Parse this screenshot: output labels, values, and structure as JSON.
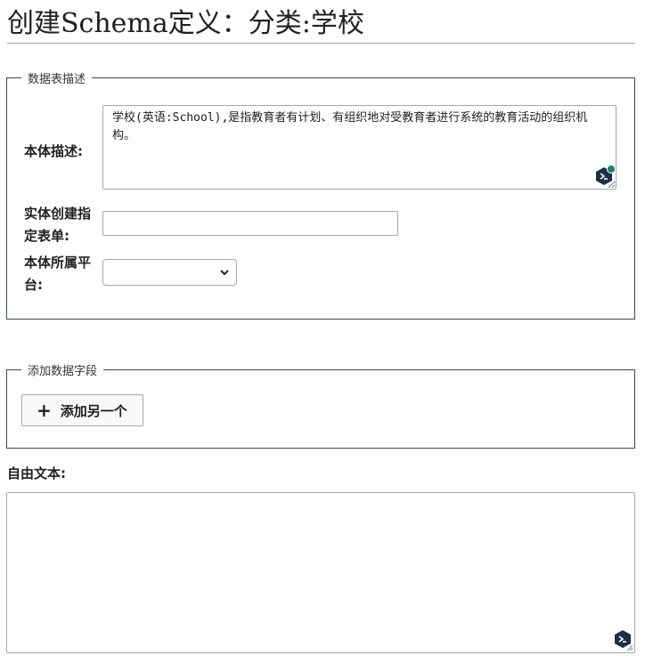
{
  "page": {
    "title": "创建Schema定义：分类:学校"
  },
  "description_section": {
    "legend": "数据表描述",
    "entity_description_label": "本体描述:",
    "entity_description_value": "学校(英语:School),是指教育者有计划、有组织地对受教育者进行系统的教育活动的组织机构。",
    "entity_form_label": "实体创建指定表单:",
    "entity_form_value": "",
    "platform_label": "本体所属平台:",
    "platform_selected": ""
  },
  "fields_section": {
    "legend": "添加数据字段",
    "add_button_label": "添加另一个",
    "add_button_icon": "plus-icon"
  },
  "free_text": {
    "label": "自由文本:",
    "value": ""
  },
  "icons": {
    "grammar_assistant": "grammar-assistant-icon",
    "accent_color": "#1b7f6b",
    "icon_color": "#1a2f4b"
  }
}
